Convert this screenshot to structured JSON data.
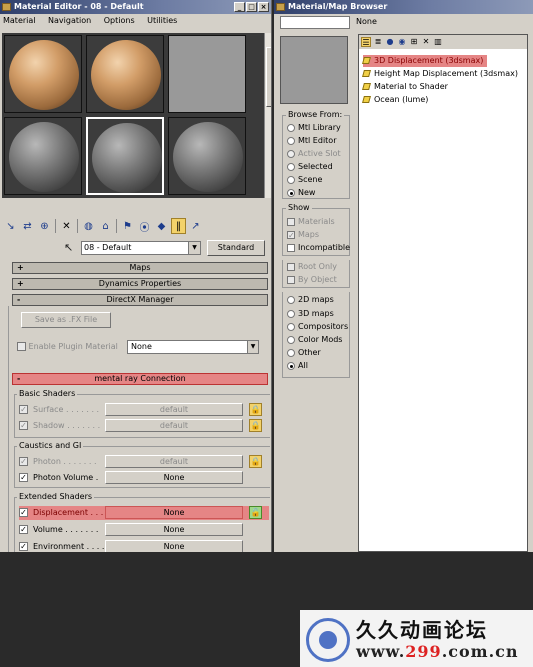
{
  "material_editor": {
    "title": "Material Editor - 08 - Default",
    "menu": [
      "Material",
      "Navigation",
      "Options",
      "Utilities"
    ],
    "name_field": "08 - Default",
    "type_button": "Standard",
    "rollouts": {
      "maps": "Maps",
      "dynamics": "Dynamics Properties",
      "directx": "DirectX Manager",
      "mental_ray": "mental ray Connection"
    },
    "directx": {
      "save_fx": "Save as .FX File",
      "enable_plugin": "Enable Plugin Material",
      "plugin_value": "None"
    },
    "basic_shaders": {
      "title": "Basic Shaders",
      "rows": [
        {
          "label": "Surface . . . . . . .",
          "value": "default"
        },
        {
          "label": "Shadow . . . . . . .",
          "value": "default"
        }
      ]
    },
    "caustics": {
      "title": "Caustics and GI",
      "rows": [
        {
          "label": "Photon . . . . . . .",
          "value": "default"
        },
        {
          "label": "Photon Volume .",
          "value": "None"
        }
      ]
    },
    "extended_shaders": {
      "title": "Extended Shaders",
      "rows": [
        {
          "label": "Displacement . . .",
          "value": "None"
        },
        {
          "label": "Volume . . . . . . .",
          "value": "None"
        },
        {
          "label": "Environment . . . .",
          "value": "None"
        }
      ]
    }
  },
  "browser": {
    "title": "Material/Map Browser",
    "none_label": "None",
    "browse_from": {
      "title": "Browse From:",
      "options": [
        "Mtl Library",
        "Mtl Editor",
        "Active Slot",
        "Selected",
        "Scene",
        "New"
      ]
    },
    "show": {
      "title": "Show",
      "options": [
        "Materials",
        "Maps",
        "Incompatible"
      ]
    },
    "filter": [
      "Root Only",
      "By Object"
    ],
    "map_types": [
      "2D maps",
      "3D maps",
      "Compositors",
      "Color Mods",
      "Other",
      "All"
    ],
    "list": [
      "3D Displacement (3dsmax)",
      "Height Map Displacement (3dsmax)",
      "Material to Shader",
      "Ocean (lume)"
    ]
  },
  "watermark": {
    "cn": "久久动画论坛",
    "url_prefix": "www.",
    "url_num": "299",
    "url_suffix": ".com.cn"
  },
  "colors": {
    "highlight": "#e58585",
    "title_bar": "#2f3f6a",
    "panel": "#d4d0c8"
  }
}
